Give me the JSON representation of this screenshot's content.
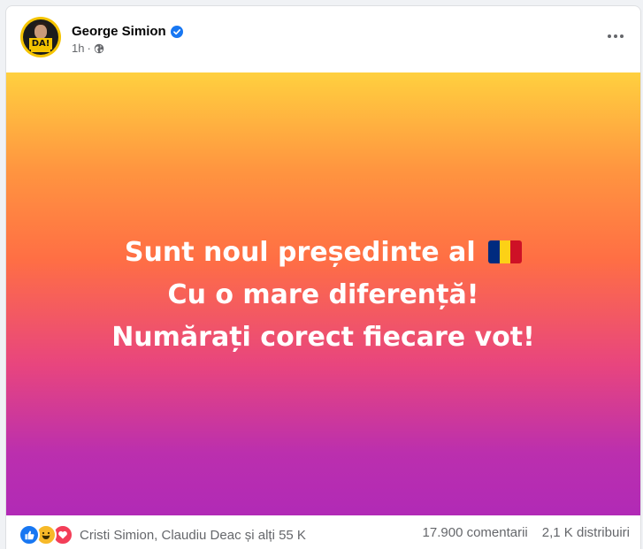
{
  "post": {
    "author": "George Simion",
    "time": "1h",
    "separator": "·",
    "avatar_badge": "DA!",
    "text_lines": [
      "Sunt noul președinte al",
      "Cu o mare diferență!",
      "Numărați corect fiecare vot!"
    ],
    "background_colors": [
      "#ffd03f",
      "#ff6f44",
      "#b12ab6"
    ],
    "flag_colors": [
      "#002b7f",
      "#fcd116",
      "#ce1126"
    ]
  },
  "footer": {
    "reactors": "Cristi Simion, Claudiu Deac și alți 55 K",
    "comments": "17.900 comentarii",
    "shares": "2,1 K distribuiri"
  },
  "icons": {
    "verified": "verified-badge-icon",
    "privacy": "globe-icon",
    "more": "more-options-icon",
    "reactions": [
      "like-reaction-icon",
      "haha-reaction-icon",
      "love-reaction-icon"
    ]
  }
}
